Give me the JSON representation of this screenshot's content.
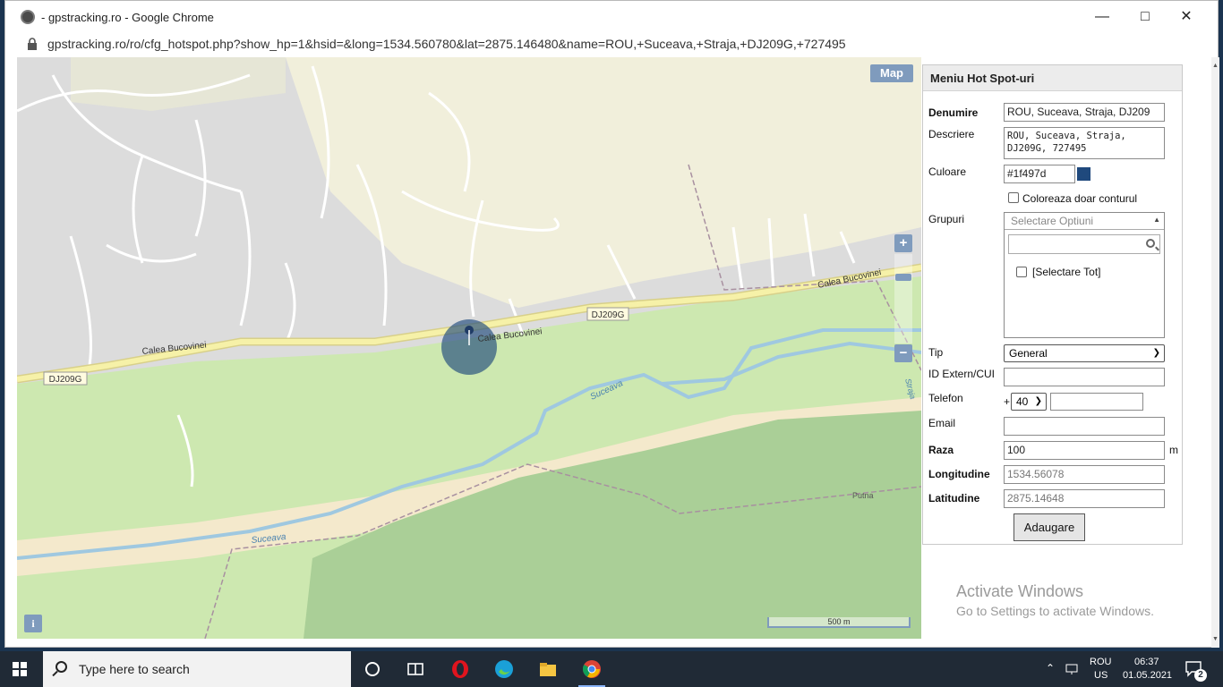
{
  "window": {
    "title": "- gpstracking.ro - Google Chrome",
    "url": "gpstracking.ro/ro/cfg_hotspot.php?show_hp=1&hsid=&long=1534.560780&lat=2875.146480&name=ROU,+Suceava,+Straja,+DJ209G,+727495"
  },
  "map": {
    "type_button": "Map",
    "zoom_in": "+",
    "zoom_out": "−",
    "info": "i",
    "scale": "500 m",
    "labels": {
      "road1": "Calea Bucovinei",
      "road2": "Calea Bucovinei",
      "road3": "Calea Bucovinei",
      "dj1": "DJ209G",
      "dj2": "DJ209G",
      "river1": "Suceava",
      "river2": "Suceava",
      "straja": "Straja",
      "putna": "Putna"
    }
  },
  "panel": {
    "title": "Meniu Hot Spot-uri",
    "denumire_label": "Denumire",
    "denumire_value": "ROU, Suceava, Straja, DJ209",
    "descriere_label": "Descriere",
    "descriere_value": "ROU, Suceava, Straja, DJ209G, 727495",
    "culoare_label": "Culoare",
    "culoare_value": "#1f497d",
    "contur_label": "Coloreaza doar conturul",
    "grupuri_label": "Grupuri",
    "grupuri_placeholder": "Selectare Optiuni",
    "select_all": "[Selectare Tot]",
    "tip_label": "Tip",
    "tip_value": "General",
    "idextern_label": "ID Extern/CUI",
    "telefon_label": "Telefon",
    "telefon_plus": "+",
    "telefon_prefix": "40",
    "email_label": "Email",
    "raza_label": "Raza",
    "raza_value": "100",
    "raza_unit": "m",
    "longitudine_label": "Longitudine",
    "longitudine_value": "1534.56078",
    "latitudine_label": "Latitudine",
    "latitudine_value": "2875.14648",
    "add_button": "Adaugare"
  },
  "activation": {
    "line1": "Activate Windows",
    "line2": "Go to Settings to activate Windows."
  },
  "taskbar": {
    "search_placeholder": "Type here to search",
    "lang1": "ROU",
    "lang2": "US",
    "time": "06:37",
    "date": "01.05.2021",
    "notifications": "2"
  },
  "colors": {
    "hotspot": "#1f497d",
    "map_button": "#7f9bbd"
  }
}
